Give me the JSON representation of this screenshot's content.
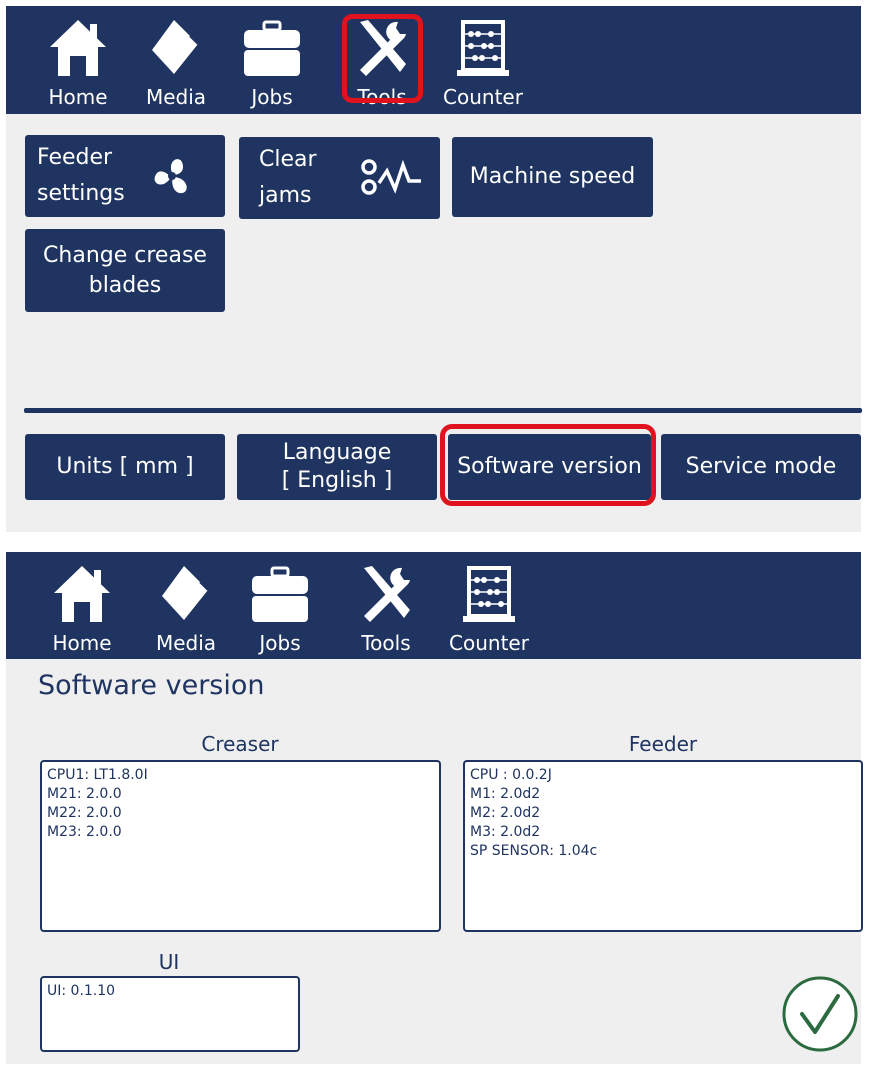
{
  "nav": {
    "items": [
      {
        "label": "Home",
        "icon": "home-icon"
      },
      {
        "label": "Media",
        "icon": "media-icon"
      },
      {
        "label": "Jobs",
        "icon": "briefcase-icon"
      },
      {
        "label": "Tools",
        "icon": "tools-icon"
      },
      {
        "label": "Counter",
        "icon": "abacus-icon"
      }
    ]
  },
  "tools": {
    "feeder_settings": [
      "Feeder",
      "settings"
    ],
    "clear_jams": [
      "Clear",
      "jams"
    ],
    "machine_speed": "Machine speed",
    "change_crease_blades": [
      "Change crease",
      "blades"
    ],
    "units": "Units [ mm ]",
    "language": [
      "Language",
      "[ English ]"
    ],
    "software_version": "Software version",
    "service_mode": "Service mode"
  },
  "software": {
    "title": "Software version",
    "creaser": {
      "title": "Creaser",
      "lines": [
        "CPU1: LT1.8.0I",
        "M21:  2.0.0",
        "M22:  2.0.0",
        "M23:  2.0.0"
      ]
    },
    "feeder": {
      "title": "Feeder",
      "lines": [
        "CPU : 0.0.2J",
        "M1:  2.0d2",
        "M2:  2.0d2",
        "M3:  2.0d2",
        "SP SENSOR:  1.04c"
      ]
    },
    "ui": {
      "title": "UI",
      "lines": [
        "UI: 0.1.10"
      ]
    },
    "confirm_icon": "checkmark-icon"
  },
  "colors": {
    "navy": "#1f3461",
    "panel_bg": "#efefef",
    "highlight": "#e0121d",
    "confirm_green": "#2c6b3f"
  }
}
